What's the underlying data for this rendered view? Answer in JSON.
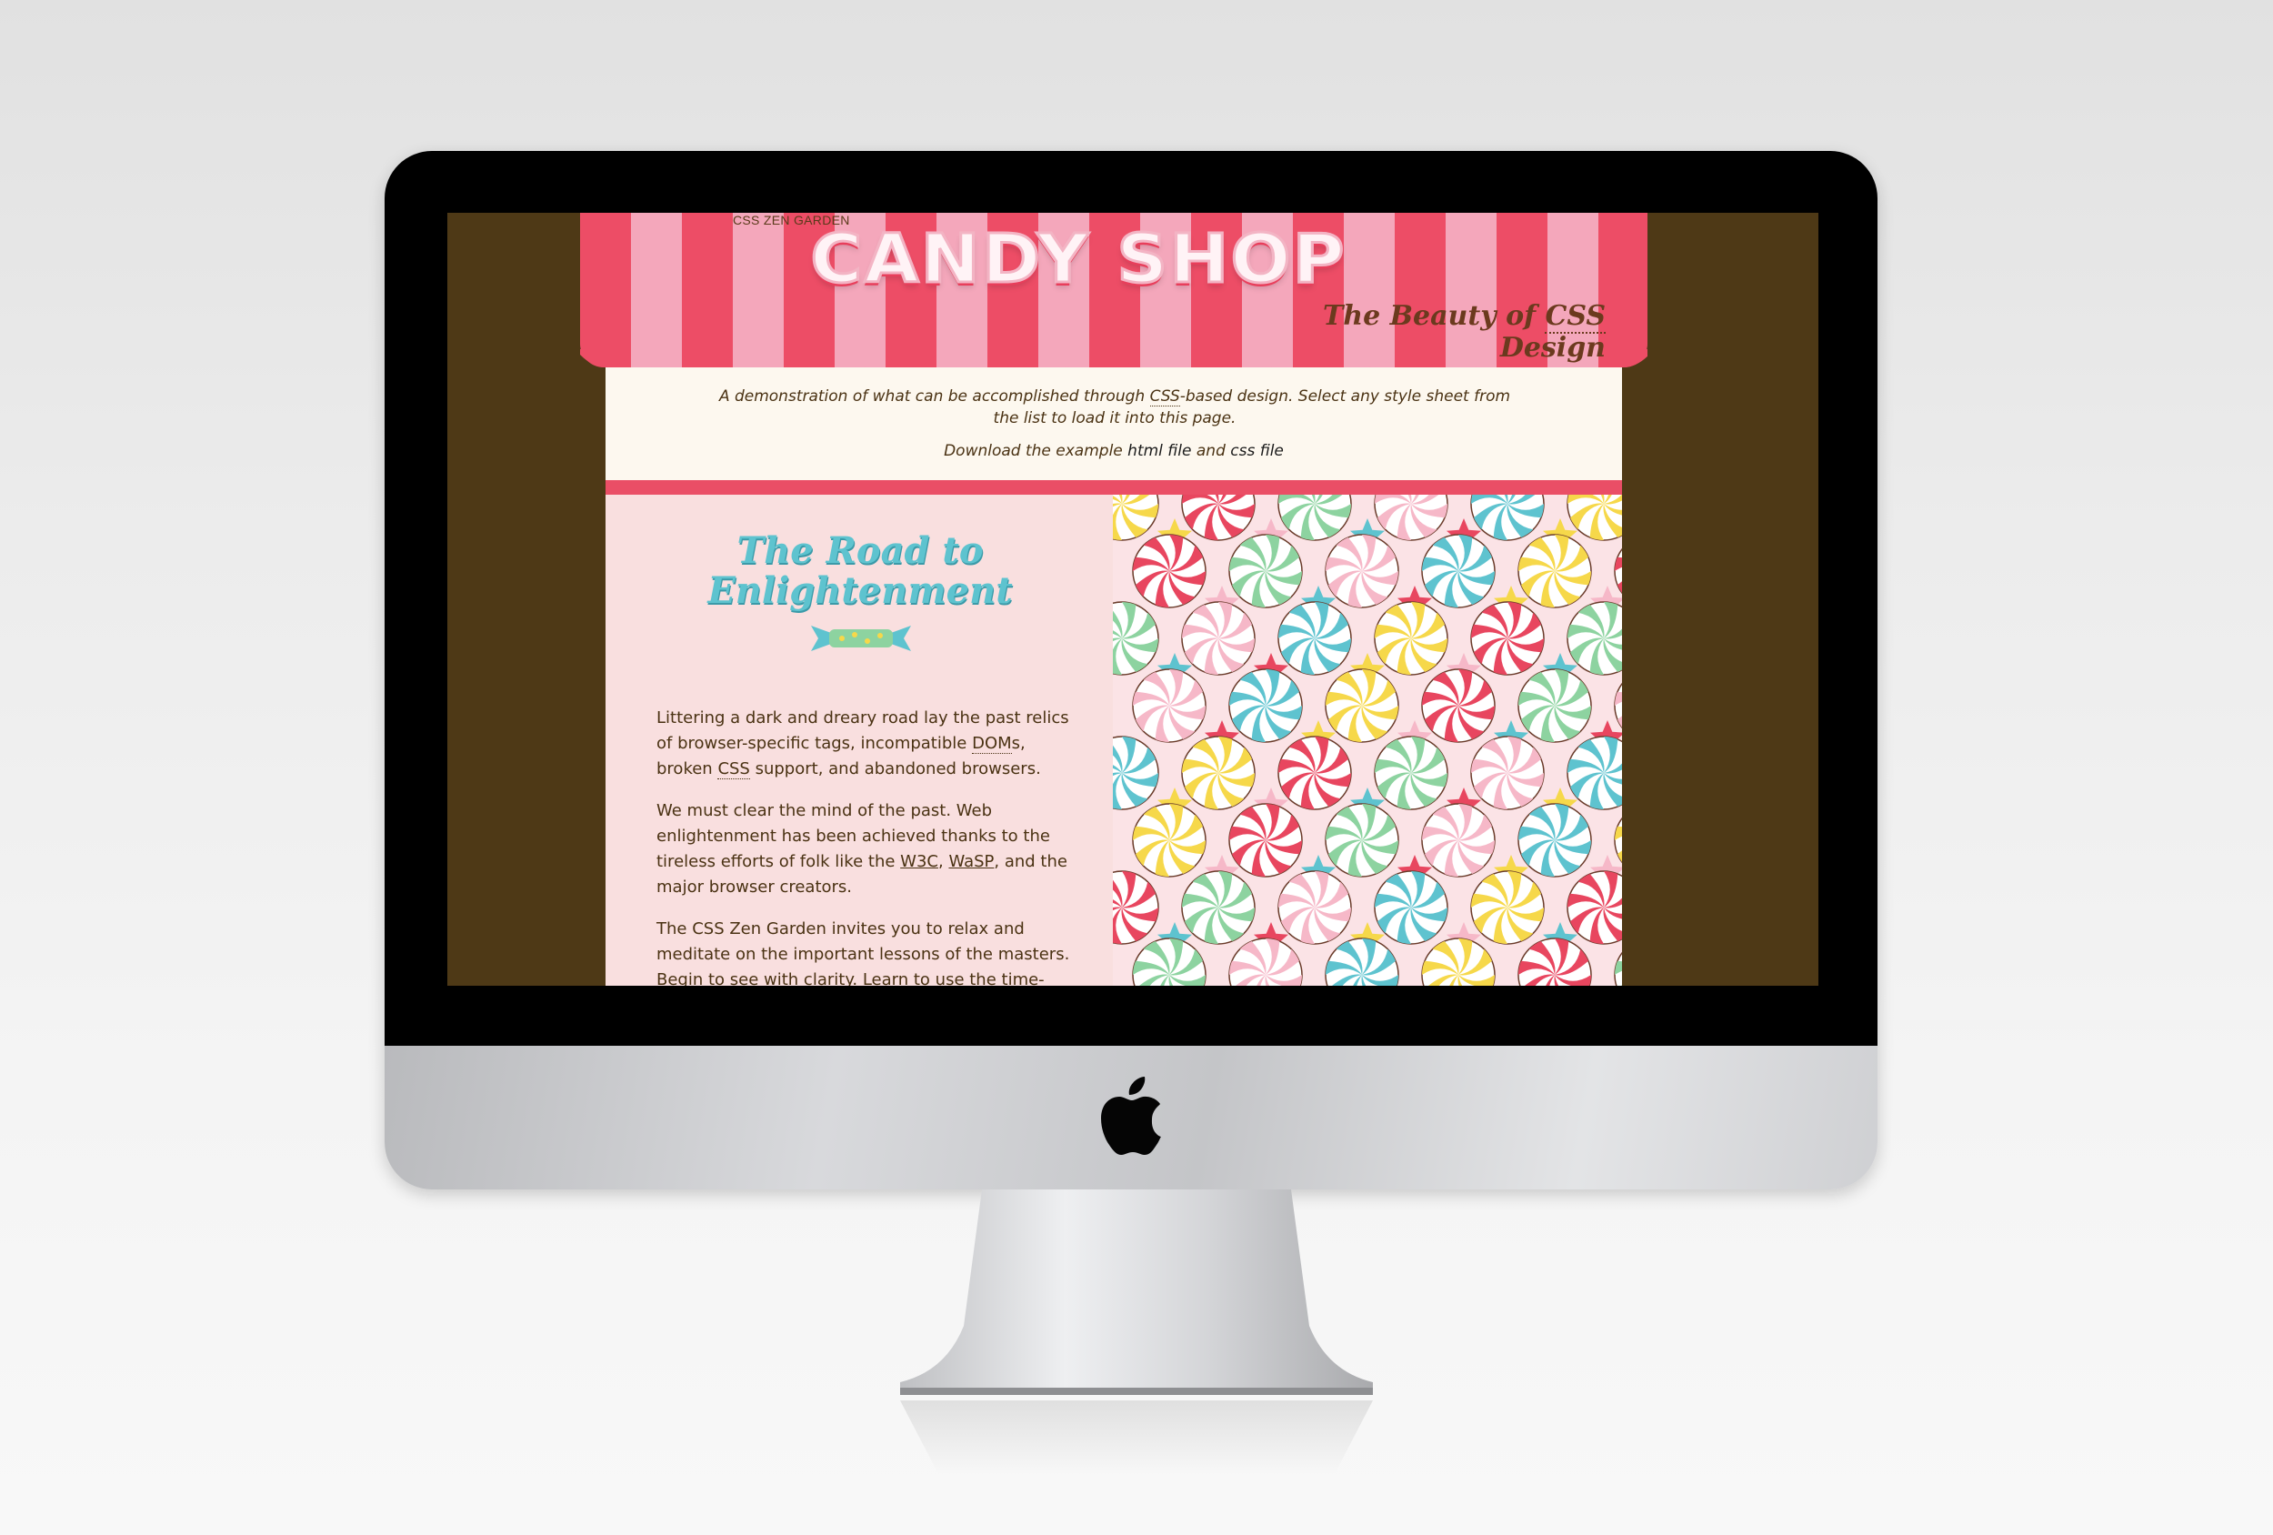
{
  "site": {
    "zen_label": "CSS ZEN GARDEN",
    "title": "CANDY SHOP",
    "tagline_pre": "The Beauty of ",
    "tagline_abbr": "CSS",
    "tagline_post": " Design"
  },
  "intro": {
    "p1_pre": "A demonstration of what can be accomplished through ",
    "p1_abbr": "CSS",
    "p1_post": "-based design. Select any style sheet from the list to load it into this page.",
    "p2_pre": "Download the example ",
    "html_link": "html file",
    "p2_mid": " and ",
    "css_link": "css file"
  },
  "road": {
    "title_line1": "The Road to",
    "title_line2": "Enlightenment",
    "para1_a": "Littering a dark and dreary road lay the past relics of browser-specific tags, incompatible ",
    "para1_abbr1": "DOM",
    "para1_b": "s, broken ",
    "para1_abbr2": "CSS",
    "para1_c": " support, and abandoned browsers.",
    "para2_a": "We must clear the mind of the past. Web enlightenment has been achieved thanks to the tireless efforts of folk like the ",
    "para2_link1": "W3C",
    "para2_sep": ", ",
    "para2_link2": "WaSP",
    "para2_b": ", and the major browser creators.",
    "para3": "The CSS Zen Garden invites you to relax and meditate on the important lessons of the masters. Begin to see with clarity. Learn to use the time-"
  },
  "colors": {
    "screen_bg": "#4e3916",
    "awning_red": "#ed4d66",
    "awning_pink": "#f4a7bb",
    "intro_bg": "#fdf8ef",
    "divider": "#ea4e66",
    "left_panel_bg": "#f9dfdf",
    "road_title": "#5ec3cf",
    "text_brown": "#4a3213"
  },
  "icons": [
    "apple-logo-icon",
    "candy-wrapper-icon"
  ]
}
